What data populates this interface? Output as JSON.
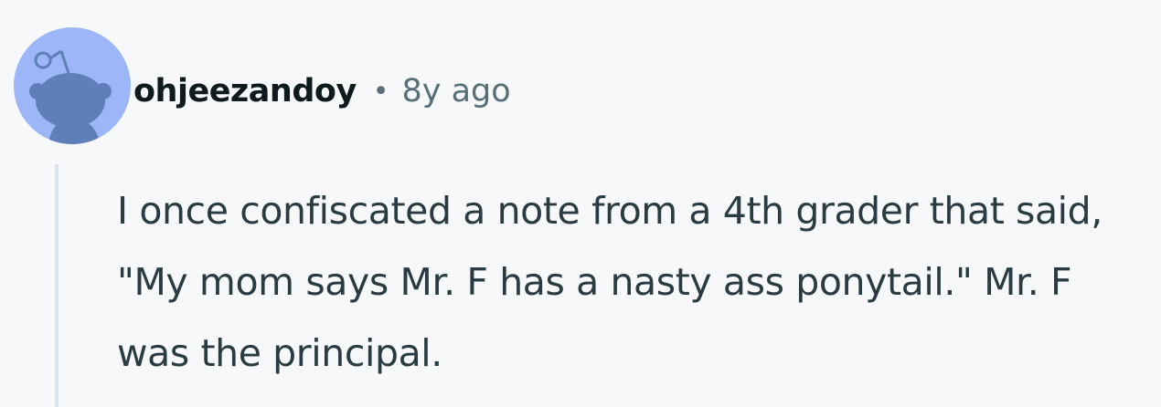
{
  "comment": {
    "author": "ohjeezandoy",
    "separator": "•",
    "timestamp": "8y ago",
    "body": "I once confiscated a note from a 4th grader that said, \"My mom says Mr. F has a nasty ass ponytail.\" Mr. F was the principal.",
    "avatar_icon": "snoo-avatar-icon"
  },
  "colors": {
    "background": "#f6f8fa",
    "avatar_bg": "#9db6f8",
    "avatar_figure": "#5f7fb8",
    "author_text": "#0f1a1c",
    "meta_text": "#576f76",
    "body_text": "#2a3c42",
    "thread_line": "#dde3ea"
  }
}
